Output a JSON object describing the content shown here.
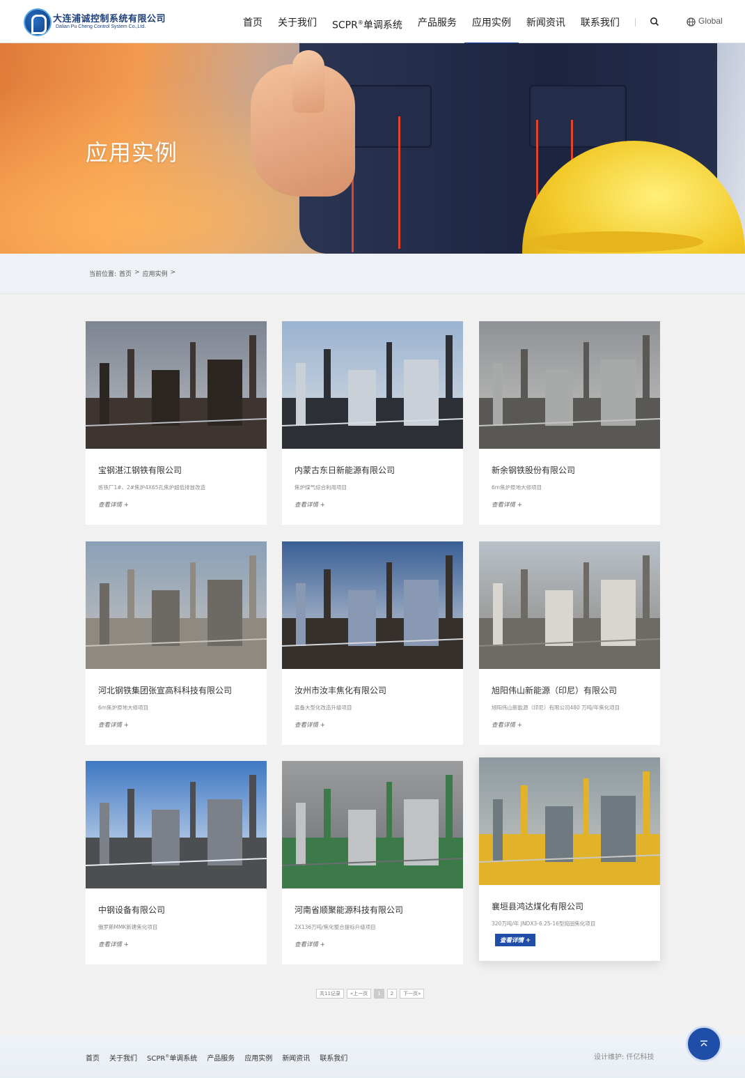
{
  "header": {
    "logo_cn": "大连浦诚控制系统有限公司",
    "logo_en": "Dalian Pu Cheng Control System Co.,Ltd.",
    "nav": [
      {
        "label": "首页",
        "active": false
      },
      {
        "label": "关于我们",
        "active": false
      },
      {
        "label": "SCPR",
        "sup": "®",
        "suffix": "单调系统",
        "active": false
      },
      {
        "label": "产品服务",
        "active": false
      },
      {
        "label": "应用实例",
        "active": true
      },
      {
        "label": "新闻资讯",
        "active": false
      },
      {
        "label": "联系我们",
        "active": false
      }
    ],
    "search_icon": "search-icon",
    "globe_icon": "globe-icon",
    "global_label": "Global",
    "accent": "#1e4ea8"
  },
  "banner": {
    "title": "应用实例"
  },
  "breadcrumb": {
    "prefix": "当前位置:",
    "items": [
      "首页",
      ">",
      "应用实例",
      ">"
    ]
  },
  "cases": [
    {
      "title": "宝钢湛江钢铁有限公司",
      "desc": "炼铁厂1#、2#焦炉4X65孔焦炉超低排放改造",
      "more": "查看详情 +"
    },
    {
      "title": "内蒙古东日新能源有限公司",
      "desc": "焦炉煤气综合利用项目",
      "more": "查看详情 +"
    },
    {
      "title": "新余钢铁股份有限公司",
      "desc": "6m焦炉原地大修项目",
      "more": "查看详情 +"
    },
    {
      "title": "河北钢铁集团张宣高科科技有限公司",
      "desc": "6m焦炉原地大修项目",
      "more": "查看详情 +"
    },
    {
      "title": "汝州市汝丰焦化有限公司",
      "desc": "装备大型化改造升级项目",
      "more": "查看详情 +"
    },
    {
      "title": "旭阳伟山新能源（印尼）有限公司",
      "desc": "旭阳伟山新能源（印尼）有限公司480 万吨/年焦化项目",
      "more": "查看详情 +"
    },
    {
      "title": "中钢设备有限公司",
      "desc": "俄罗斯MMK新建焦化项目",
      "more": "查看详情 +"
    },
    {
      "title": "河南省顺聚能源科技有限公司",
      "desc": "2X136万吨/焦化整合提标升级项目",
      "more": "查看详情 +"
    },
    {
      "title": "襄垣县鸿达煤化有限公司",
      "desc": "320万吨/年 JNDX3-6.25-16型捣固焦化项目",
      "more": "查看详情 +",
      "hover": true
    }
  ],
  "pagination": {
    "total": "共11记录",
    "prev": "«上一页",
    "pages": [
      "1",
      "2"
    ],
    "current": "1",
    "next": "下一页»"
  },
  "footer": {
    "nav": [
      {
        "label": "首页"
      },
      {
        "label": "关于我们"
      },
      {
        "label": "SCPR",
        "sup": "®",
        "suffix": "单调系统"
      },
      {
        "label": "产品服务"
      },
      {
        "label": "应用实例"
      },
      {
        "label": "新闻资讯"
      },
      {
        "label": "联系我们"
      }
    ],
    "credit": "设计维护:   仟亿科技",
    "back_top_icon": "arrow-up-icon"
  }
}
